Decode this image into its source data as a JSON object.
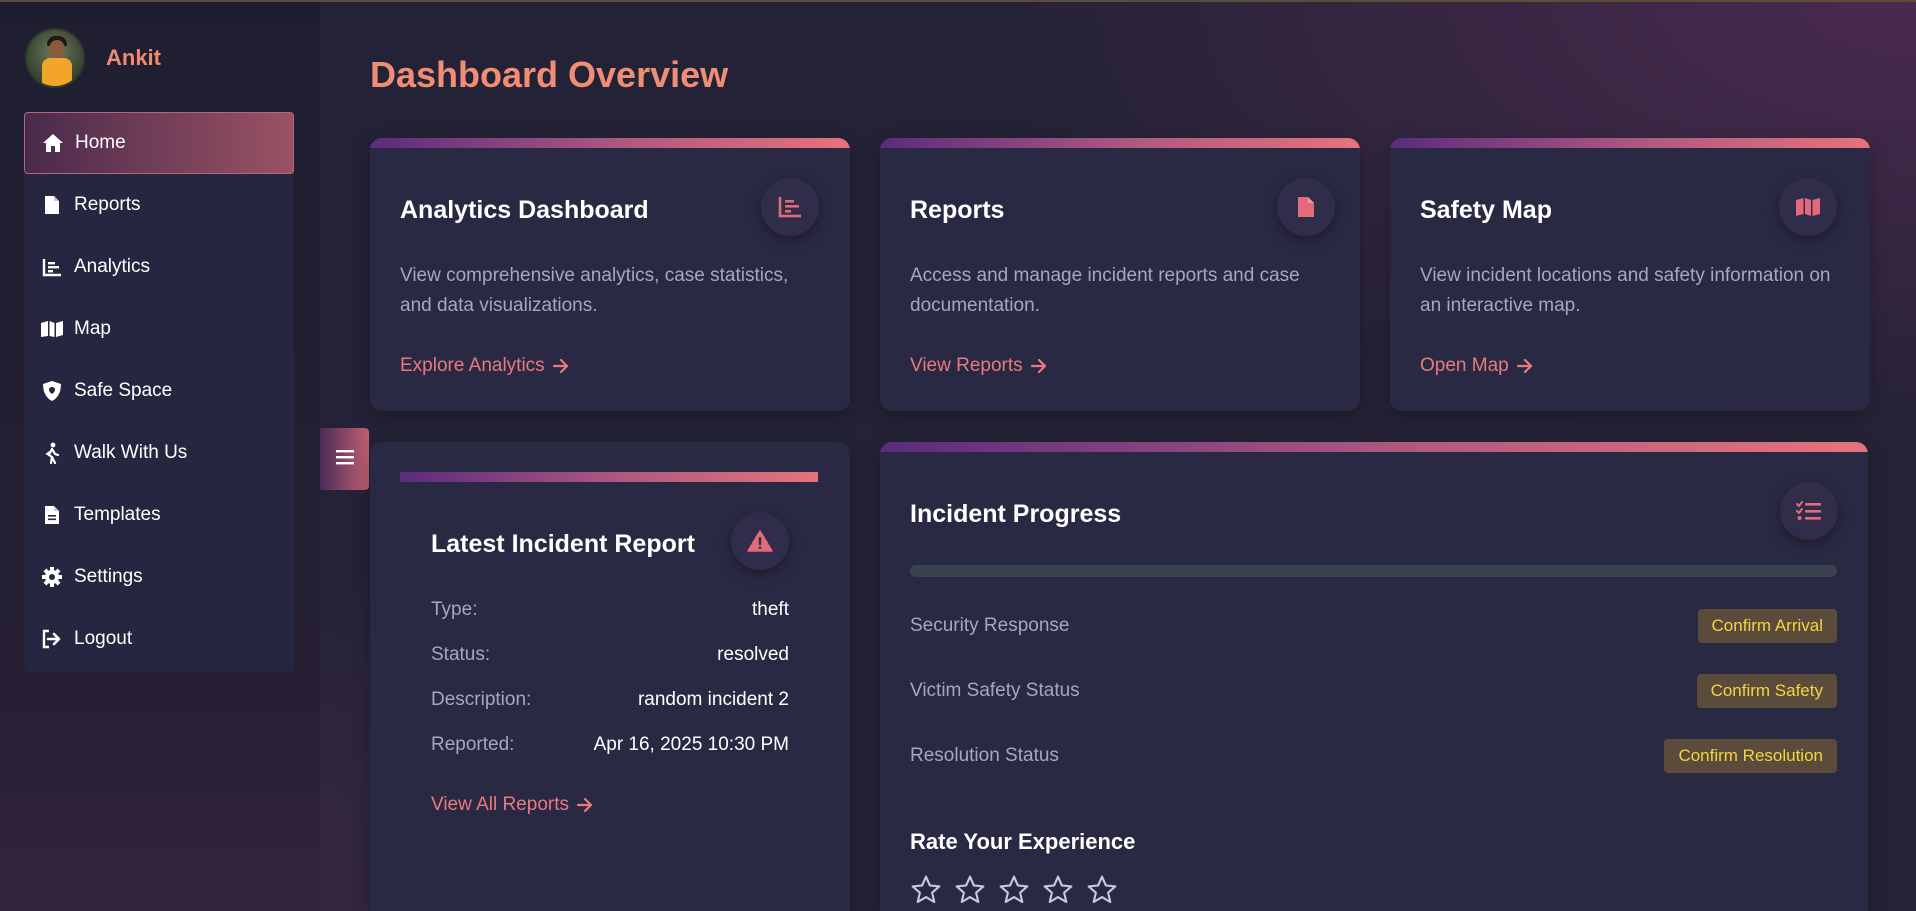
{
  "user": {
    "name": "Ankit"
  },
  "sidebar": {
    "items": [
      {
        "label": "Home",
        "icon": "home-icon"
      },
      {
        "label": "Reports",
        "icon": "file-icon"
      },
      {
        "label": "Analytics",
        "icon": "chart-icon"
      },
      {
        "label": "Map",
        "icon": "map-icon"
      },
      {
        "label": "Safe Space",
        "icon": "shield-icon"
      },
      {
        "label": "Walk With Us",
        "icon": "walking-icon"
      },
      {
        "label": "Templates",
        "icon": "file-icon"
      },
      {
        "label": "Settings",
        "icon": "gear-icon"
      },
      {
        "label": "Logout",
        "icon": "logout-icon"
      }
    ],
    "active": "Home"
  },
  "page": {
    "title": "Dashboard Overview"
  },
  "cards": [
    {
      "title": "Analytics Dashboard",
      "description": "View comprehensive analytics, case statistics, and data visualizations.",
      "link": "Explore Analytics",
      "icon": "chart-icon"
    },
    {
      "title": "Reports",
      "description": "Access and manage incident reports and case documentation.",
      "link": "View Reports",
      "icon": "file-icon"
    },
    {
      "title": "Safety Map",
      "description": "View incident locations and safety information on an interactive map.",
      "link": "Open Map",
      "icon": "map-icon"
    }
  ],
  "latest_incident": {
    "title": "Latest Incident Report",
    "icon": "warning-icon",
    "fields": [
      {
        "label": "Type:",
        "value": "theft"
      },
      {
        "label": "Status:",
        "value": "resolved"
      },
      {
        "label": "Description:",
        "value": "random incident 2"
      },
      {
        "label": "Reported:",
        "value": "Apr 16, 2025 10:30 PM"
      }
    ],
    "link": "View All Reports"
  },
  "incident_progress": {
    "title": "Incident Progress",
    "icon": "tasks-icon",
    "progress": 0,
    "steps": [
      {
        "label": "Security Response",
        "action": "Confirm Arrival"
      },
      {
        "label": "Victim Safety Status",
        "action": "Confirm Safety"
      },
      {
        "label": "Resolution Status",
        "action": "Confirm Resolution"
      }
    ],
    "rating_title": "Rate Your Experience",
    "rating": {
      "value": 0,
      "max": 5
    }
  },
  "colors": {
    "background": "#242236",
    "card": "#2a2943",
    "accent": "#e87a7f",
    "title": "#ef8e74",
    "button_text": "#f5d442"
  }
}
